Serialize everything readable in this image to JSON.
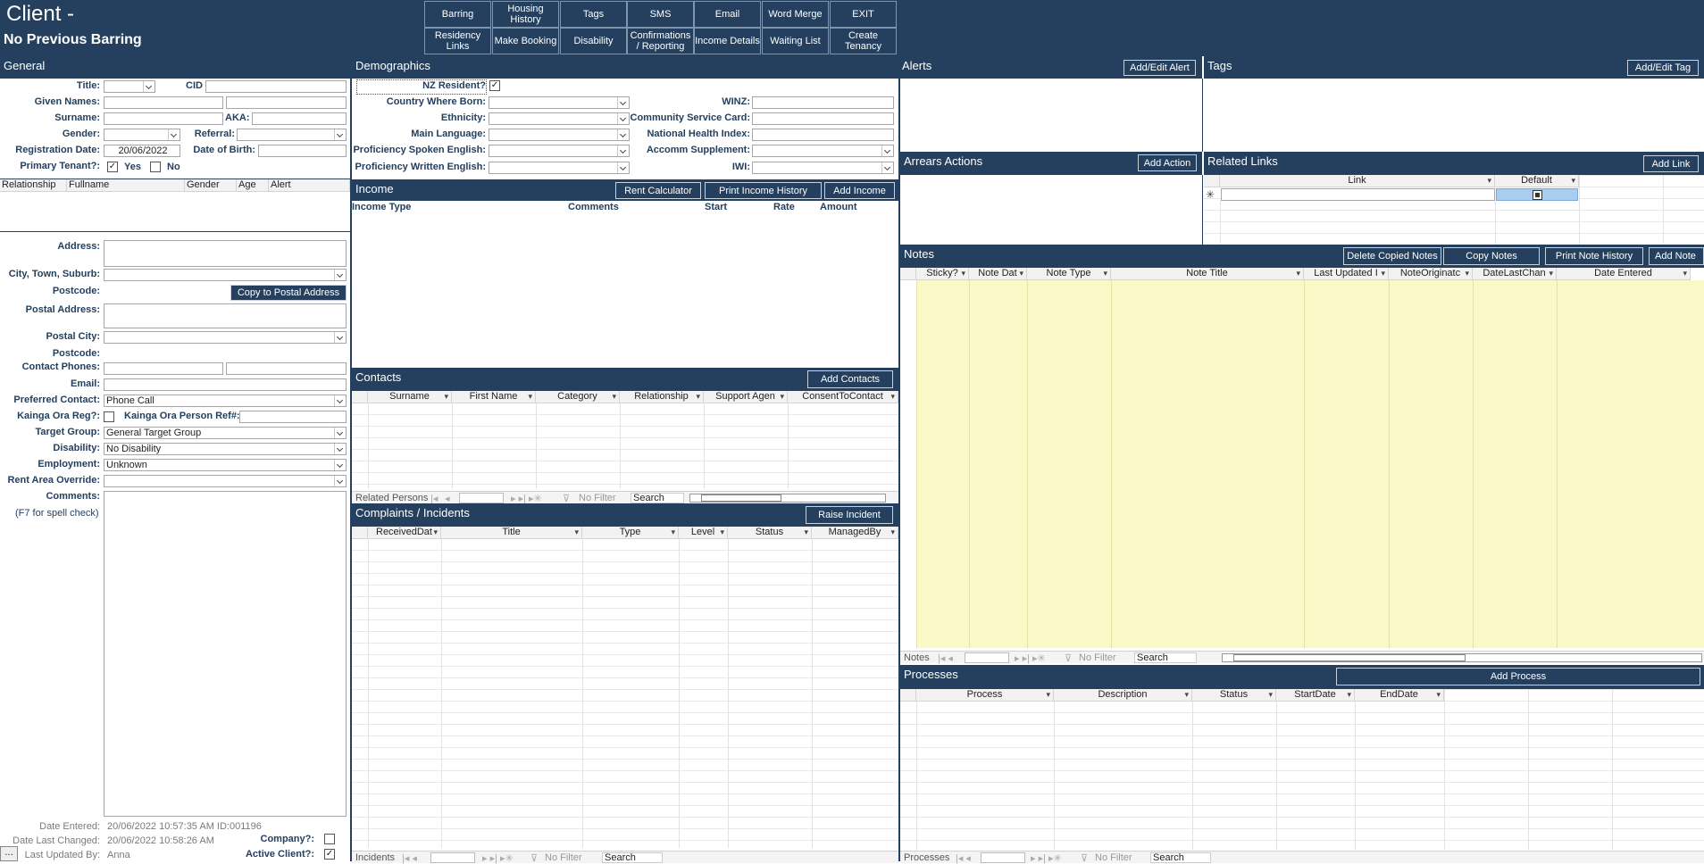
{
  "header": {
    "title": "Client -",
    "barring_status": "No Previous Barring",
    "buttons_row1": [
      "Barring",
      "Housing History",
      "Tags",
      "SMS",
      "Email",
      "Word Merge",
      "EXIT"
    ],
    "buttons_row2": [
      "Residency Links",
      "Make Booking",
      "Disability",
      "Confirmations / Reporting",
      "Income Details",
      "Waiting List",
      "Create Tenancy"
    ]
  },
  "general": {
    "section_title": "General",
    "title_label": "Title:",
    "cid_label": "CID",
    "given_names_label": "Given Names:",
    "surname_label": "Surname:",
    "aka_label": "AKA:",
    "gender_label": "Gender:",
    "referral_label": "Referral:",
    "registration_date_label": "Registration Date:",
    "registration_date": "20/06/2022",
    "dob_label": "Date of Birth:",
    "primary_tenant_label": "Primary Tenant?:",
    "yes_label": "Yes",
    "no_label": "No",
    "primary_tenant_yes": true,
    "relations_columns": [
      "Relationship",
      "Fullname",
      "Gender",
      "Age",
      "Alert"
    ],
    "address_label": "Address:",
    "city_label": "City, Town, Suburb:",
    "postcode_label": "Postcode:",
    "copy_postal_button": "Copy to Postal Address",
    "postal_address_label": "Postal Address:",
    "postal_city_label": "Postal City:",
    "postal_postcode_label": "Postcode:",
    "contact_phones_label": "Contact Phones:",
    "email_label": "Email:",
    "preferred_contact_label": "Preferred Contact:",
    "preferred_contact": "Phone Call",
    "kainga_reg_label": "Kainga Ora Reg?:",
    "kainga_ref_label": "Kainga Ora Person Ref#:",
    "target_group_label": "Target Group:",
    "target_group": "General Target Group",
    "disability_label": "Disability:",
    "disability": "No Disability",
    "employment_label": "Employment:",
    "employment": "Unknown",
    "rent_area_label": "Rent Area Override:",
    "comments_label": "Comments:",
    "spell_check_hint": "(F7 for spell check)",
    "date_entered_label": "Date Entered:",
    "date_entered": "20/06/2022 10:57:35 AM ID:001196",
    "date_changed_label": "Date Last Changed:",
    "date_changed": "20/06/2022 10:58:26 AM",
    "updated_by_label": "Last Updated By:",
    "updated_by": "Anna",
    "company_label": "Company?:",
    "active_label": "Active Client?:",
    "active_client": true,
    "record_selector": "..."
  },
  "demographics": {
    "section_title": "Demographics",
    "nz_resident_label": "NZ Resident?",
    "nz_resident": true,
    "country_label": "Country Where Born:",
    "ethnicity_label": "Ethnicity:",
    "language_label": "Main Language:",
    "spoken_label": "Proficiency Spoken English:",
    "written_label": "Proficiency Written English:",
    "winz_label": "WINZ:",
    "csc_label": "Community Service Card:",
    "nhi_label": "National Health Index:",
    "accomm_label": "Accomm Supplement:",
    "iwi_label": "IWI:"
  },
  "income": {
    "section_title": "Income",
    "buttons": [
      "Rent Calculator",
      "Print Income History",
      "Add Income"
    ],
    "columns": [
      "Income Type",
      "Comments",
      "Start",
      "Rate",
      "Amount"
    ]
  },
  "contacts": {
    "section_title": "Contacts",
    "add_button": "Add Contacts",
    "columns": [
      "Surname",
      "First Name",
      "Category",
      "Relationship",
      "Support Agen",
      "ConsentToContact"
    ],
    "nav_label": "Related Persons",
    "filter_label": "No Filter",
    "search_label": "Search"
  },
  "complaints": {
    "section_title": "Complaints / Incidents",
    "raise_button": "Raise Incident",
    "columns": [
      "ReceivedDat",
      "Title",
      "Type",
      "Level",
      "Status",
      "ManagedBy"
    ],
    "nav_label": "Incidents",
    "filter_label": "No Filter",
    "search_label": "Search"
  },
  "alerts": {
    "section_title": "Alerts",
    "button": "Add/Edit Alert"
  },
  "tags": {
    "section_title": "Tags",
    "button": "Add/Edit Tag"
  },
  "arrears": {
    "section_title": "Arrears Actions",
    "button": "Add Action"
  },
  "links": {
    "section_title": "Related Links",
    "button": "Add Link",
    "columns": [
      "Link",
      "Default"
    ],
    "new_row_marker": "✳"
  },
  "notes": {
    "section_title": "Notes",
    "buttons": [
      "Delete Copied Notes",
      "Copy Notes",
      "Print Note History",
      "Add Note"
    ],
    "columns": [
      "Sticky?",
      "Note Dat",
      "Note Type",
      "Note Title",
      "Last Updated I",
      "NoteOriginatc",
      "DateLastChan",
      "Date Entered"
    ],
    "nav_label": "Notes",
    "filter_label": "No Filter",
    "search_label": "Search"
  },
  "processes": {
    "section_title": "Processes",
    "button": "Add Process",
    "columns": [
      "Process",
      "Description",
      "Status",
      "StartDate",
      "EndDate"
    ],
    "nav_label": "Processes",
    "filter_label": "No Filter",
    "search_label": "Search"
  },
  "colors": {
    "header": "#24405e",
    "notes_bg": "#fbf8c8",
    "selected_cell": "#a9cdf0"
  }
}
